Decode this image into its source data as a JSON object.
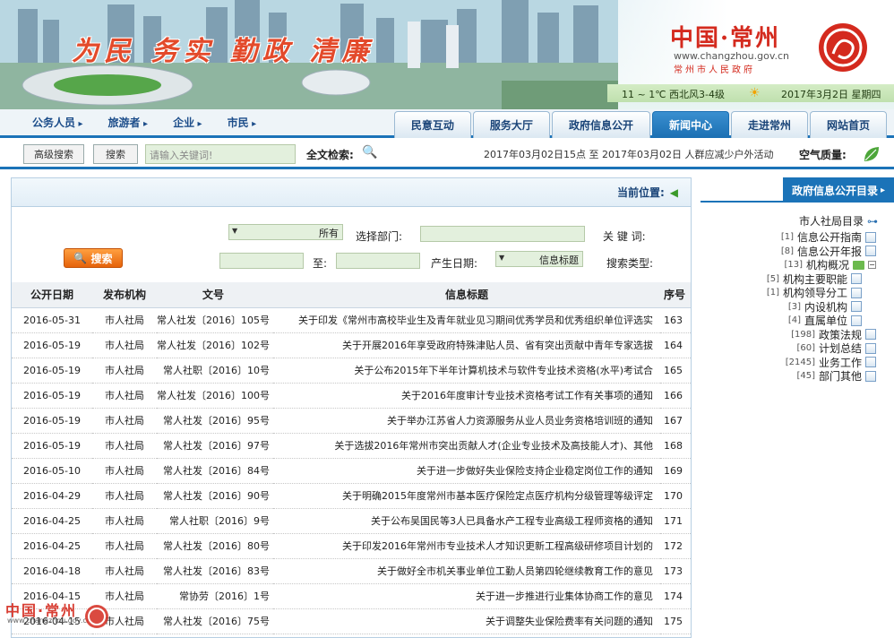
{
  "banner": {
    "slogan": "为民 务实 勤政 清廉",
    "logo_cn": "中国·常州",
    "logo_url": "www.changzhou.gov.cn",
    "logo_gov": "常州市人民政府",
    "date": "2017年3月2日 星期四",
    "weather": "11 ~ 1℃ 西北风3-4级"
  },
  "nav": {
    "left_links": [
      "公务人员",
      "旅游者",
      "企业",
      "市民"
    ],
    "tabs": [
      "民意互动",
      "服务大厅",
      "政府信息公开",
      "新闻中心",
      "走进常州",
      "网站首页"
    ],
    "active_tab": "新闻中心"
  },
  "topsearch": {
    "advanced_label": "高级搜索",
    "search_label": "搜索",
    "input_placeholder": "请输入关键词!",
    "fulltext_label": "全文检索:",
    "notice": "2017年03月02日15点 至 2017年03月02日 人群应减少户外活动",
    "air_label": "空气质量:"
  },
  "main": {
    "crumb": "当前位置:",
    "form": {
      "keyword_label": "关 键 词:",
      "keyword_value": "",
      "dept_label": "选择部门:",
      "dept_value": "所有",
      "search_type_label": "搜索类型:",
      "search_type_value": "信息标题",
      "date_label": "产生日期:",
      "date_to": "至:",
      "search_button": "搜索"
    },
    "columns": {
      "no": "序号",
      "title": "信息标题",
      "doc": "文号",
      "org": "发布机构",
      "date": "公开日期"
    },
    "rows": [
      {
        "no": "163",
        "title": "关于印发《常州市高校毕业生及青年就业见习期间优秀学员和优秀组织单位评选实",
        "doc": "常人社发〔2016〕105号",
        "org": "市人社局",
        "date": "2016-05-31"
      },
      {
        "no": "164",
        "title": "关于开展2016年享受政府特殊津贴人员、省有突出贡献中青年专家选拔",
        "doc": "常人社发〔2016〕102号",
        "org": "市人社局",
        "date": "2016-05-19"
      },
      {
        "no": "165",
        "title": "关于公布2015年下半年计算机技术与软件专业技术资格(水平)考试合",
        "doc": "常人社职〔2016〕10号",
        "org": "市人社局",
        "date": "2016-05-19"
      },
      {
        "no": "166",
        "title": "关于2016年度审计专业技术资格考试工作有关事项的通知",
        "doc": "常人社发〔2016〕100号",
        "org": "市人社局",
        "date": "2016-05-19"
      },
      {
        "no": "167",
        "title": "关于举办江苏省人力资源服务从业人员业务资格培训班的通知",
        "doc": "常人社发〔2016〕95号",
        "org": "市人社局",
        "date": "2016-05-19"
      },
      {
        "no": "168",
        "title": "关于选拔2016年常州市突出贡献人才(企业专业技术及高技能人才)、其他",
        "doc": "常人社发〔2016〕97号",
        "org": "市人社局",
        "date": "2016-05-19"
      },
      {
        "no": "169",
        "title": "关于进一步做好失业保险支持企业稳定岗位工作的通知",
        "doc": "常人社发〔2016〕84号",
        "org": "市人社局",
        "date": "2016-05-10"
      },
      {
        "no": "170",
        "title": "关于明确2015年度常州市基本医疗保险定点医疗机构分级管理等级评定",
        "doc": "常人社发〔2016〕90号",
        "org": "市人社局",
        "date": "2016-04-29"
      },
      {
        "no": "171",
        "title": "关于公布吴国民等3人已具备水产工程专业高级工程师资格的通知",
        "doc": "常人社职〔2016〕9号",
        "org": "市人社局",
        "date": "2016-04-25"
      },
      {
        "no": "172",
        "title": "关于印发2016年常州市专业技术人才知识更新工程高级研修项目计划的",
        "doc": "常人社发〔2016〕80号",
        "org": "市人社局",
        "date": "2016-04-25"
      },
      {
        "no": "173",
        "title": "关于做好全市机关事业单位工勤人员第四轮继续教育工作的意见",
        "doc": "常人社发〔2016〕83号",
        "org": "市人社局",
        "date": "2016-04-18"
      },
      {
        "no": "174",
        "title": "关于进一步推进行业集体协商工作的意见",
        "doc": "常协劳〔2016〕1号",
        "org": "市人社局",
        "date": "2016-04-15"
      },
      {
        "no": "175",
        "title": "关于调整失业保险费率有关问题的通知",
        "doc": "常人社发〔2016〕75号",
        "org": "市人社局",
        "date": "2016-04-15"
      }
    ]
  },
  "sidebar": {
    "title": "政府信息公开目录",
    "root": "市人社局目录",
    "items": [
      {
        "label": "信息公开指南",
        "count": "[1]",
        "level": 1
      },
      {
        "label": "信息公开年报",
        "count": "[8]",
        "level": 1
      },
      {
        "label": "机构概况",
        "count": "[13]",
        "level": 1,
        "expanded": true
      },
      {
        "label": "机构主要职能",
        "count": "[5]",
        "level": 2
      },
      {
        "label": "机构领导分工",
        "count": "[1]",
        "level": 2
      },
      {
        "label": "内设机构",
        "count": "[3]",
        "level": 2
      },
      {
        "label": "直属单位",
        "count": "[4]",
        "level": 2
      },
      {
        "label": "政策法规",
        "count": "[198]",
        "level": 1
      },
      {
        "label": "计划总结",
        "count": "[60]",
        "level": 1
      },
      {
        "label": "业务工作",
        "count": "[2145]",
        "level": 1
      },
      {
        "label": "部门其他",
        "count": "[45]",
        "level": 1
      }
    ]
  },
  "watermark": {
    "cn": "中国·常州",
    "url": "www.changzhou.gov.cn"
  },
  "colors": {
    "primary_blue": "#1b73b8",
    "field_green": "#e3f0dd",
    "accent_red": "#d42a1e",
    "button_orange": "#e5620a"
  }
}
